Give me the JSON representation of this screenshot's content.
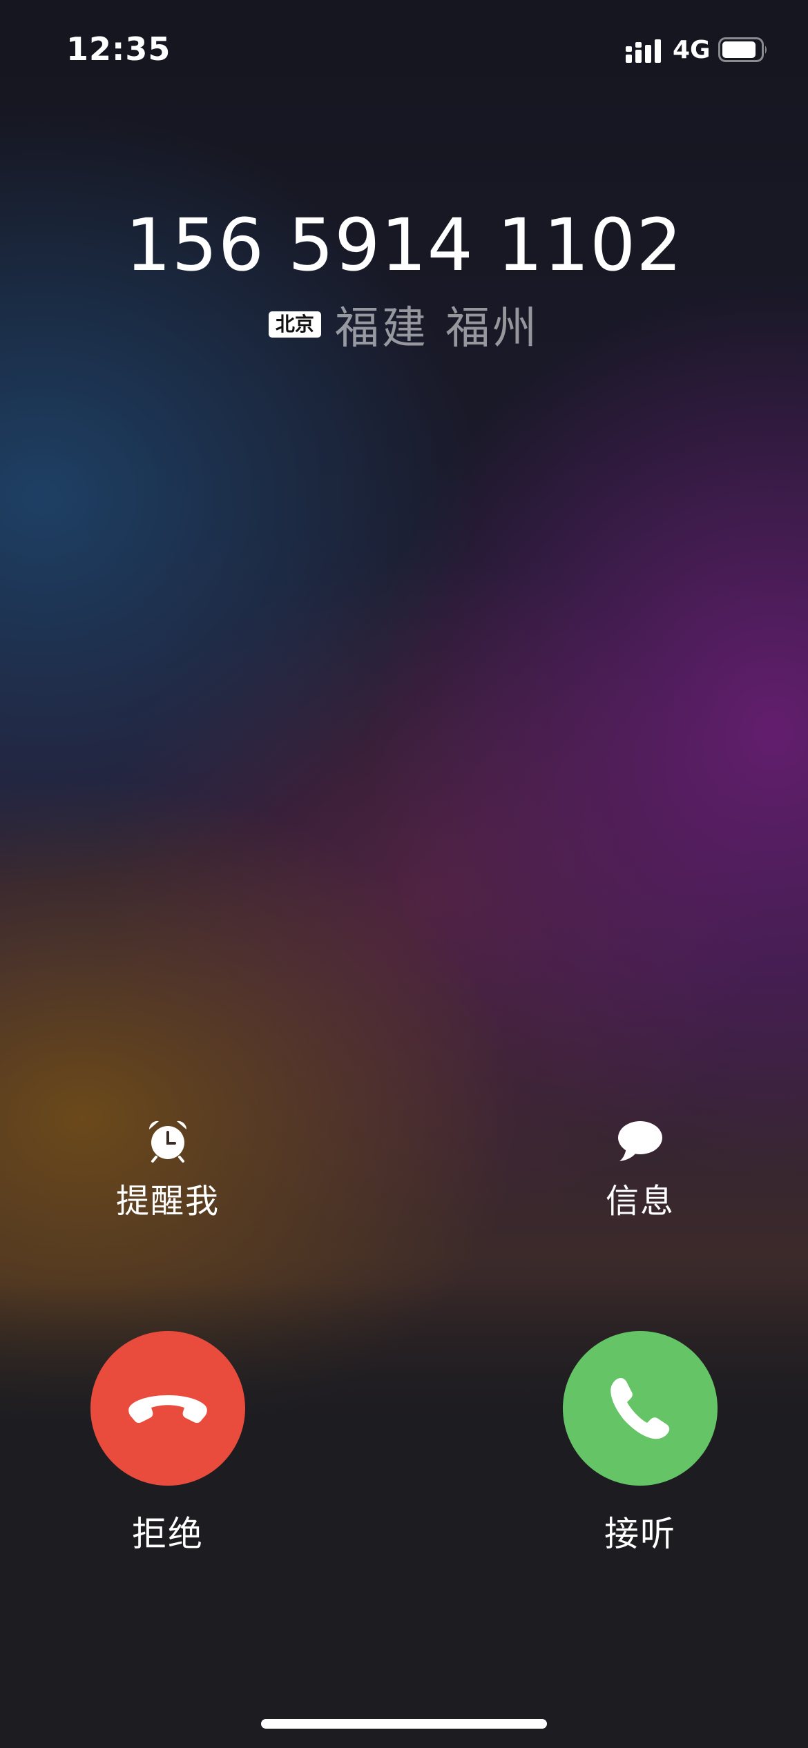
{
  "status_bar": {
    "time": "12:35",
    "network": "4G",
    "signal_icon": "signal-bars-icon",
    "battery_icon": "battery-icon",
    "battery_level": 0.85
  },
  "caller": {
    "number": "156 5914 1102",
    "tag": "北京",
    "location": "福建 福州"
  },
  "actions": {
    "remind_label": "提醒我",
    "remind_icon": "alarm-clock-icon",
    "message_label": "信息",
    "message_icon": "speech-bubble-icon",
    "decline_label": "拒绝",
    "decline_icon": "phone-hangup-icon",
    "accept_label": "接听",
    "accept_icon": "phone-icon"
  },
  "colors": {
    "decline": "#e94c3d",
    "accept": "#65c466"
  }
}
